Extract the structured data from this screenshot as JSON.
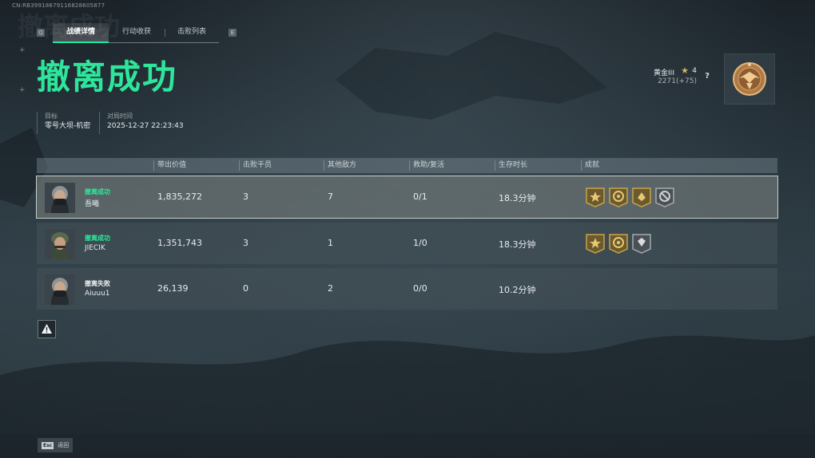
{
  "session_id": "CN:RB39918679116828605877",
  "tabs": {
    "left_key": "Q",
    "right_key": "E",
    "items": [
      {
        "label": "战绩详情",
        "active": true
      },
      {
        "label": "行动收获",
        "active": false
      },
      {
        "label": "击败列表",
        "active": false
      }
    ]
  },
  "result": {
    "title": "撤离成功",
    "color": "#2ee69b"
  },
  "meta": {
    "target_label": "目标",
    "target_value": "零号大坝-机密",
    "time_label": "对局时间",
    "time_value": "2025-12-27 22:23:43"
  },
  "rank": {
    "name": "黄金III",
    "level": "4",
    "points": "2271(+75)",
    "help": "?",
    "icons": {
      "star": "star-icon",
      "badge": "rank-emblem-icon"
    }
  },
  "table": {
    "headers": [
      "带出价值",
      "击败干员",
      "其他敌方",
      "救助/复活",
      "生存时长",
      "成就"
    ],
    "rows": [
      {
        "status": "撤离成功",
        "status_type": "ok",
        "name": "吾曦",
        "value": "1,835,272",
        "kills": "3",
        "other": "7",
        "assist": "0/1",
        "time": "18.3分钟",
        "achievements": [
          "gold",
          "gold",
          "gold",
          "silver"
        ],
        "highlight": true
      },
      {
        "status": "撤离成功",
        "status_type": "ok",
        "name": "JIECIK",
        "value": "1,351,743",
        "kills": "3",
        "other": "1",
        "assist": "1/0",
        "time": "18.3分钟",
        "achievements": [
          "gold",
          "gold",
          "silver"
        ],
        "highlight": false
      },
      {
        "status": "撤离失败",
        "status_type": "fail",
        "name": "Aiuuu1",
        "value": "26,139",
        "kills": "0",
        "other": "2",
        "assist": "0/0",
        "time": "10.2分钟",
        "achievements": [],
        "highlight": false
      }
    ]
  },
  "footer": {
    "esc_key": "Esc",
    "esc_label": "返回"
  },
  "colors": {
    "accent": "#2ee69b",
    "gold_badge": "#c9a24a",
    "silver_badge": "#8e969a"
  }
}
